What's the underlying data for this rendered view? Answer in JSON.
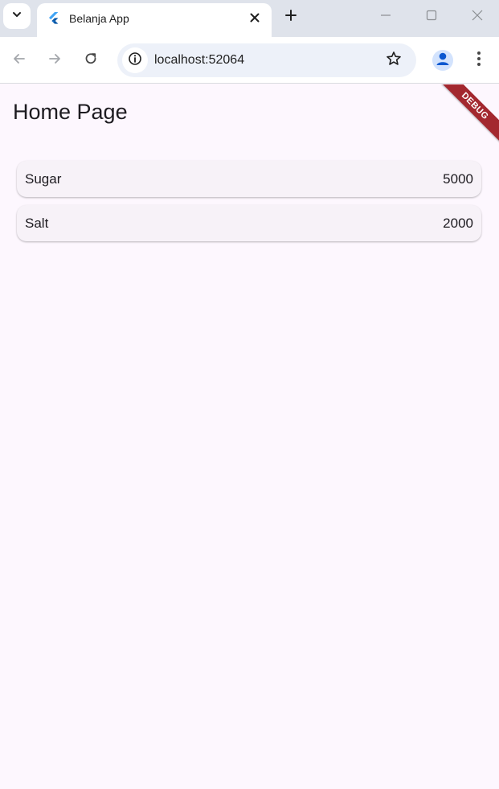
{
  "browser": {
    "tab": {
      "title": "Belanja App"
    },
    "address_bar": {
      "url": "localhost:52064"
    }
  },
  "app": {
    "page_title": "Home Page",
    "debug_label": "DEBUG",
    "items": [
      {
        "name": "Sugar",
        "price": "5000"
      },
      {
        "name": "Salt",
        "price": "2000"
      }
    ]
  },
  "colors": {
    "background": "#fdf7fe",
    "item_background": "#f7f2f8",
    "debug_banner": "#a3282f",
    "tabstrip": "#dfe3eb"
  },
  "icons": {
    "tab_search": "chevron-down-icon",
    "favicon": "flutter-logo-icon",
    "tab_close": "close-icon",
    "new_tab": "plus-icon",
    "minimize": "minimize-icon",
    "maximize": "maximize-icon",
    "window_close": "close-icon",
    "back": "arrow-left-icon",
    "forward": "arrow-right-icon",
    "reload": "reload-icon",
    "site_info": "info-icon",
    "bookmark": "star-icon",
    "profile": "person-icon",
    "menu": "kebab-menu-icon"
  }
}
